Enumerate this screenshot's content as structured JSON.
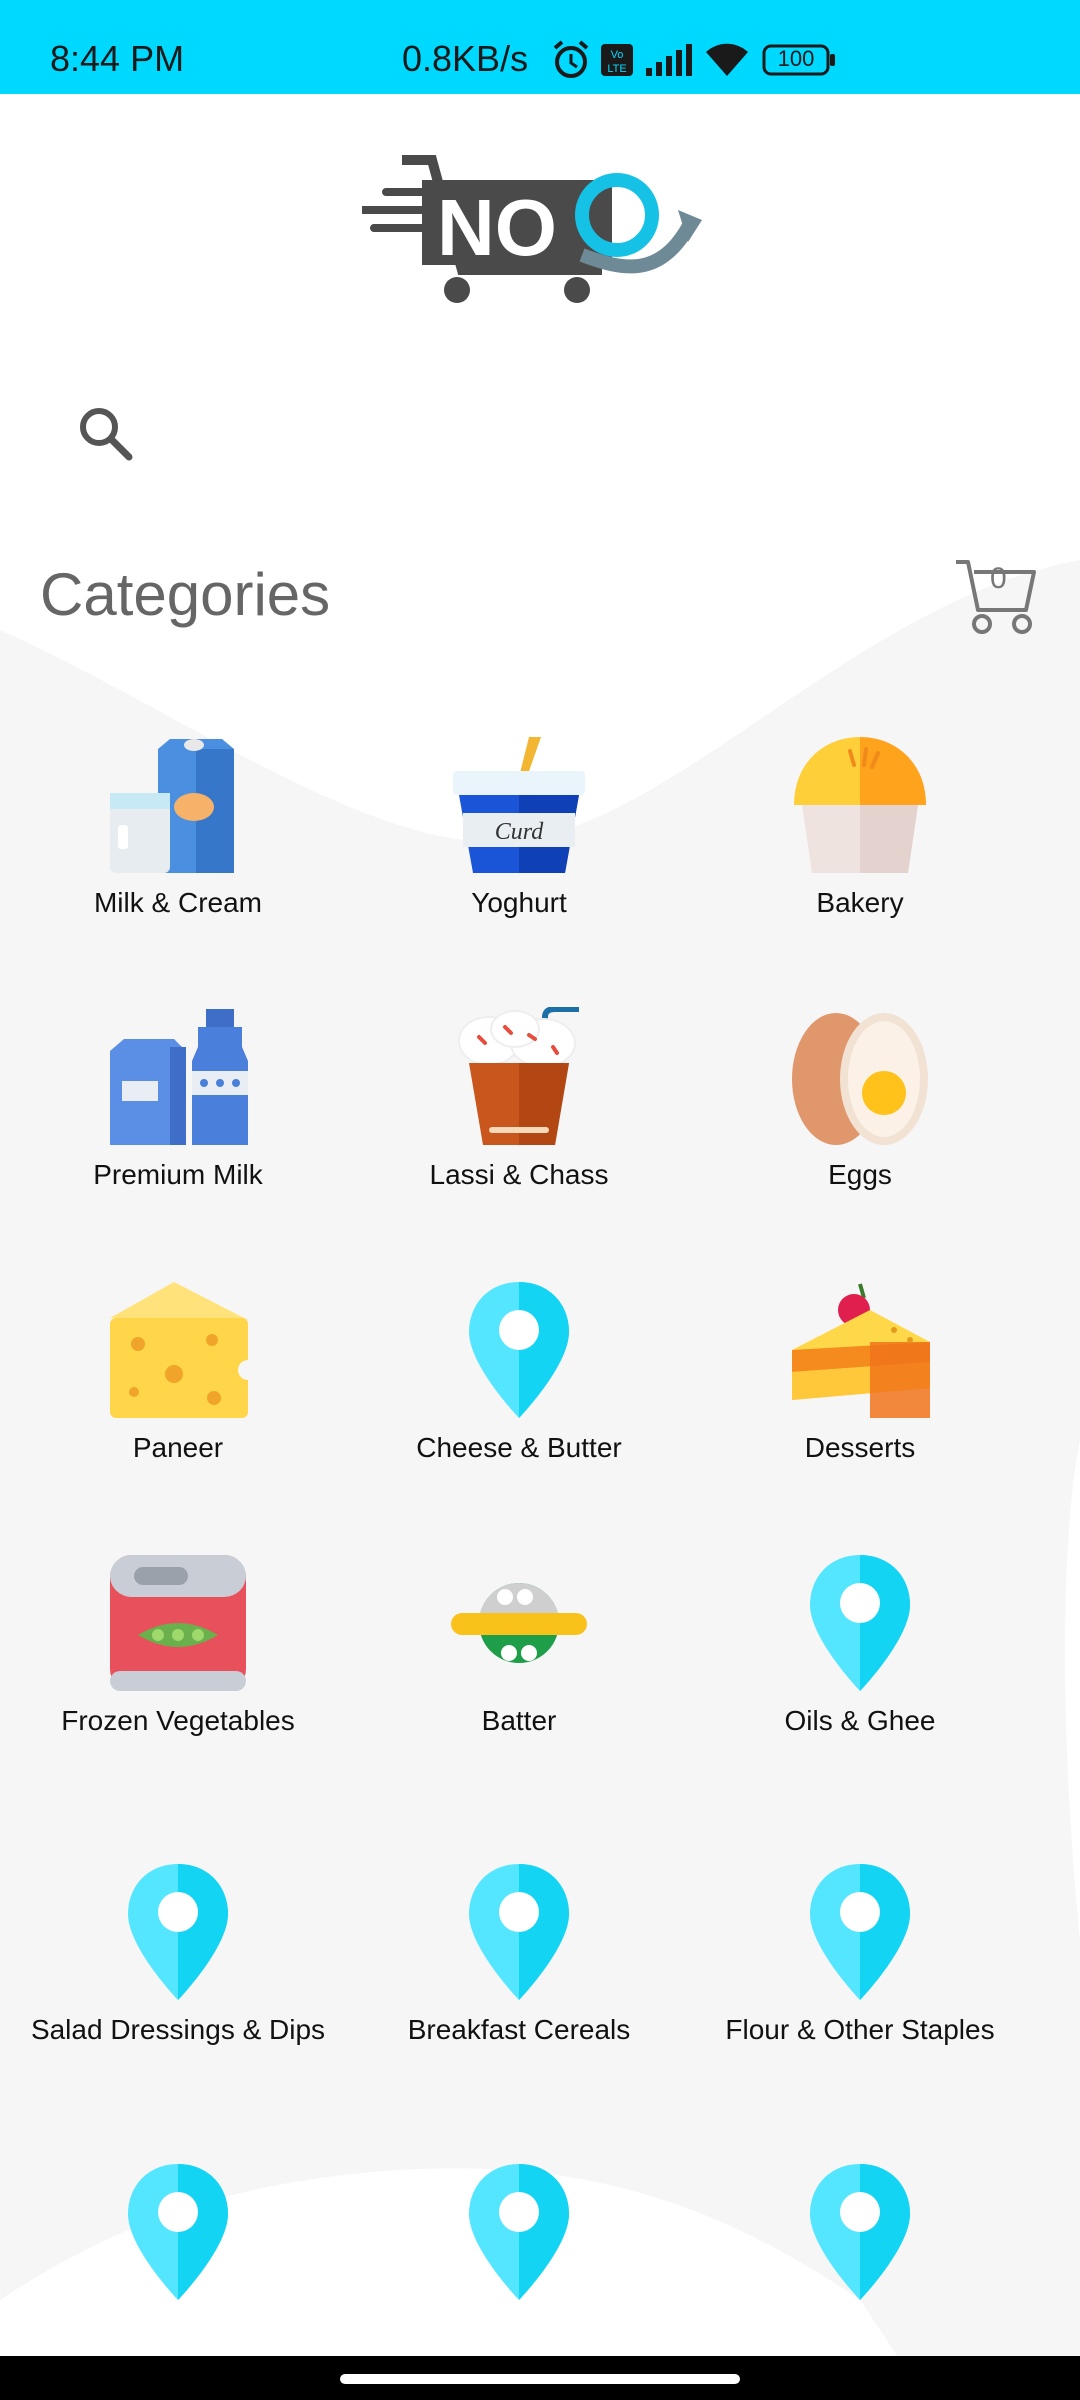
{
  "status_bar": {
    "time": "8:44 PM",
    "network_speed": "0.8KB/s",
    "battery": "100",
    "icons": [
      "alarm-icon",
      "volte-icon",
      "signal-icon",
      "wifi-icon",
      "battery-icon"
    ]
  },
  "header": {
    "logo_text": "NOQ",
    "search_icon": "search-icon"
  },
  "categories": {
    "title": "Categories",
    "cart_count": "0",
    "items": [
      {
        "label": "Milk & Cream",
        "icon": "milk-cream-icon"
      },
      {
        "label": "Yoghurt",
        "icon": "curd-cup-icon"
      },
      {
        "label": "Bakery",
        "icon": "muffin-icon"
      },
      {
        "label": "Premium Milk",
        "icon": "milk-bottle-icon"
      },
      {
        "label": "Lassi & Chass",
        "icon": "lassi-glass-icon"
      },
      {
        "label": "Eggs",
        "icon": "egg-icon"
      },
      {
        "label": "Paneer",
        "icon": "cheese-block-icon"
      },
      {
        "label": "Cheese & Butter",
        "icon": "map-pin-icon"
      },
      {
        "label": "Desserts",
        "icon": "cake-slice-icon"
      },
      {
        "label": "Frozen Vegetables",
        "icon": "peas-can-icon"
      },
      {
        "label": "Batter",
        "icon": "batter-packet-icon"
      },
      {
        "label": "Oils & Ghee",
        "icon": "map-pin-icon"
      },
      {
        "label": "Salad Dressings & Dips",
        "icon": "map-pin-icon"
      },
      {
        "label": "Breakfast Cereals",
        "icon": "map-pin-icon"
      },
      {
        "label": "Flour & Other Staples",
        "icon": "map-pin-icon"
      },
      {
        "label": "",
        "icon": "map-pin-icon"
      },
      {
        "label": "",
        "icon": "map-pin-icon"
      },
      {
        "label": "",
        "icon": "map-pin-icon"
      }
    ]
  },
  "colors": {
    "status_bar": "#00d9ff",
    "pin": "#55e6ff",
    "pin_dark": "#14d4f4",
    "background_grey": "#f6f6f6",
    "title": "#666666"
  }
}
